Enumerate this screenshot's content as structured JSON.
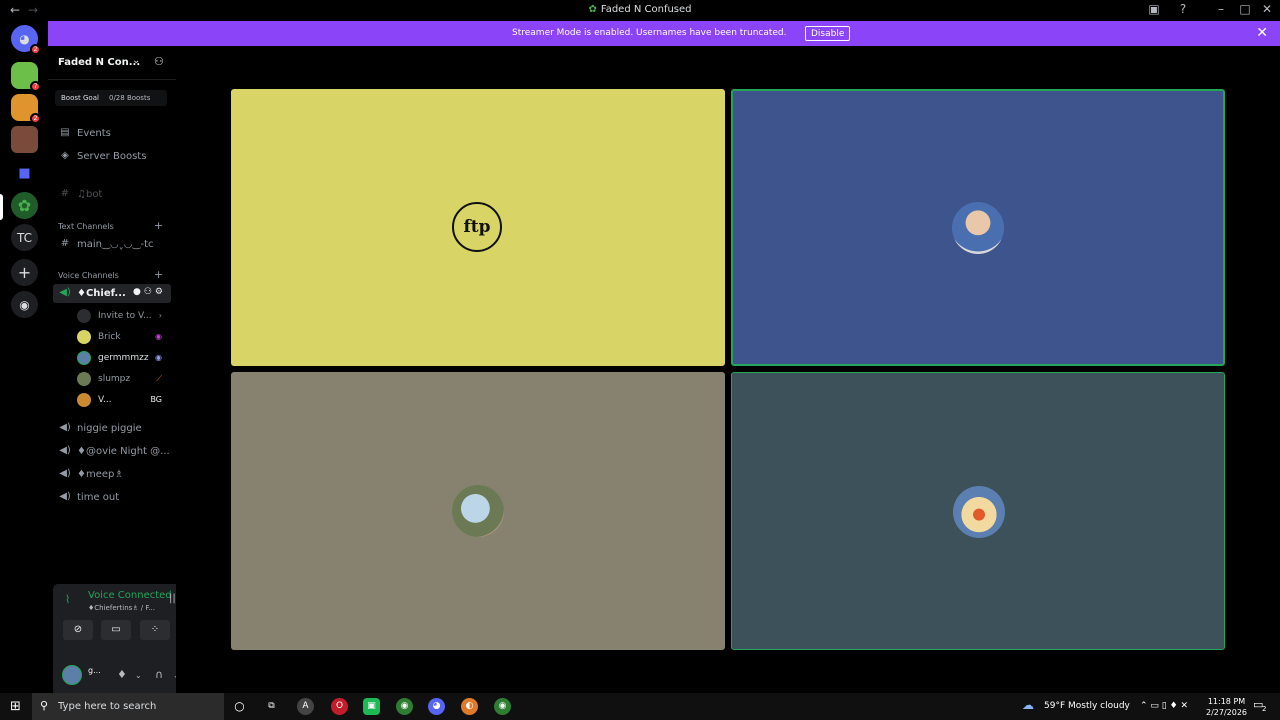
{
  "window": {
    "title": "Faded N Confused",
    "controls": [
      "←",
      "→"
    ]
  },
  "banner": {
    "text": "Streamer Mode is enabled. Usernames have been truncated.",
    "button": "Disable"
  },
  "rail": {
    "badges": [
      "2",
      "7",
      "2",
      "TC"
    ]
  },
  "server": {
    "name": "Faded N Con...",
    "boost_goal": "Boost Goal",
    "boost_count": "0/28 Boosts"
  },
  "sidebar": {
    "events": "Events",
    "server_boosts": "Server Boosts",
    "bot_channel": "♫bot",
    "text_category": "Text Channels",
    "main_channel": "main‿◡ˬ◡‿-tc",
    "voice_category": "Voice Channels",
    "active_voice": "♦Chief...",
    "invite": "Invite to V...",
    "voice_channels": [
      "niggie piggie",
      "♦@ovie Night @...",
      "♦meep♗",
      "time out"
    ]
  },
  "voice_users": [
    {
      "name": "Brick",
      "tag": "◉"
    },
    {
      "name": "germmmzz",
      "tag": "◉"
    },
    {
      "name": "slumpz",
      "tag": "⟋"
    },
    {
      "name": "V...",
      "tag": "BG"
    }
  ],
  "voice_panel": {
    "status": "Voice Connected",
    "channel": "♦Chiefertins♗ / F...",
    "user": "g..."
  },
  "taskbar": {
    "search_placeholder": "Type here to search",
    "weather": "59°F  Mostly cloudy",
    "time": "11:18 PM",
    "date": "2/27/2026",
    "notifications": "2"
  },
  "colors": {
    "accent": "#8b44f7",
    "tile1": "#d8d566",
    "tile2": "#3d548d",
    "tile3": "#87826f",
    "tile4": "#3c5159",
    "speaking": "#23a55a"
  }
}
